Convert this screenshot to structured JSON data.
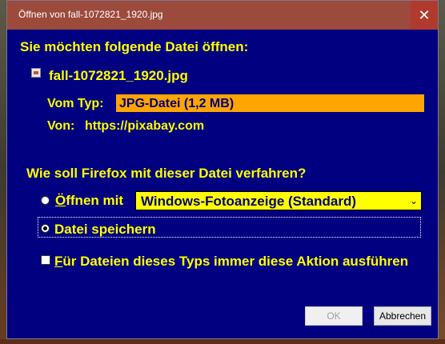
{
  "window": {
    "title": "Öffnen von fall-1072821_1920.jpg",
    "close_glyph": "✕"
  },
  "dialog": {
    "heading": "Sie möchten folgende Datei öffnen:",
    "file_name": "fall-1072821_1920.jpg",
    "type_label": "Vom Typ:",
    "type_value": "JPG-Datei (1,2 MB)",
    "source_label": "Von:",
    "source_value": "https://pixabay.com",
    "question": "Wie soll Firefox mit dieser Datei verfahren?",
    "open_with": {
      "label_accel": "Ö",
      "label_rest": "ffnen mit",
      "selected_app": "Windows-Fotoanzeige (Standard)",
      "checked": false
    },
    "save_file": {
      "label": "Datei speichern",
      "checked": true
    },
    "always_do": {
      "label_accel": "F",
      "label_rest": "ür Dateien dieses Typs immer diese Aktion ausführen",
      "checked": false
    }
  },
  "buttons": {
    "ok": "OK",
    "cancel": "Abbrechen"
  },
  "colors": {
    "background": "#000080",
    "text": "#ffff00",
    "type_highlight": "#ffa500",
    "titlebar": "#9c4a3c"
  }
}
